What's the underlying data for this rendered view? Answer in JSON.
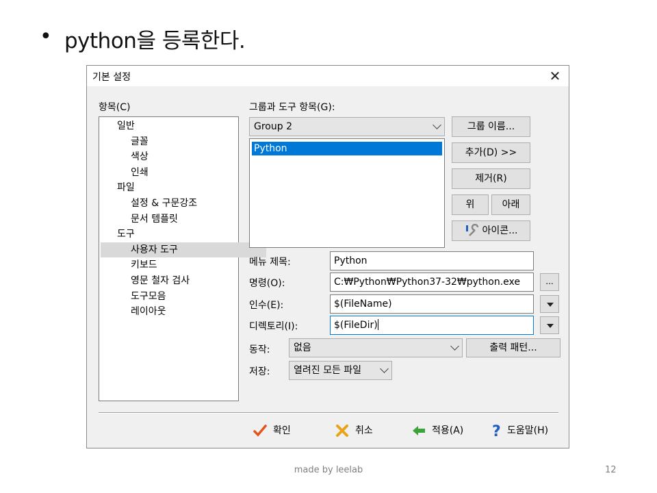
{
  "slide": {
    "bullet": "•",
    "title": "python을 등록한다.",
    "footer": "made by leelab",
    "page_number": "12"
  },
  "dialog": {
    "title": "기본 설정",
    "close": "✕",
    "items_label": "항목(C)",
    "tree": [
      {
        "label": "일반",
        "level": 0
      },
      {
        "label": "글꼴",
        "level": 1
      },
      {
        "label": "색상",
        "level": 1
      },
      {
        "label": "인쇄",
        "level": 1
      },
      {
        "label": "파일",
        "level": 0
      },
      {
        "label": "설정 & 구문강조",
        "level": 1
      },
      {
        "label": "문서 템플릿",
        "level": 1
      },
      {
        "label": "도구",
        "level": 0
      },
      {
        "label": "사용자 도구",
        "level": 1,
        "selected": true
      },
      {
        "label": "키보드",
        "level": 1
      },
      {
        "label": "영문 철자 검사",
        "level": 1
      },
      {
        "label": "도구모음",
        "level": 1
      },
      {
        "label": "레이아웃",
        "level": 1
      }
    ],
    "group_label": "그룹과 도구 항목(G):",
    "group_select": "Group 2",
    "tool_list": [
      "Python"
    ],
    "buttons": {
      "group_name": "그룹 이름...",
      "add": "추가(D) >>",
      "remove": "제거(R)",
      "up": "위",
      "down": "아래",
      "icon": "아이콘..."
    },
    "fields": {
      "menu_title_label": "메뉴 제목:",
      "menu_title_value": "Python",
      "command_label": "명령(O):",
      "command_value": "C:₩Python₩Python37-32₩python.exe",
      "command_browse": "...",
      "args_label": "인수(E):",
      "args_value": "$(FileName)",
      "dir_label": "디렉토리(I):",
      "dir_value": "$(FileDir)"
    },
    "action_label": "동작:",
    "action_value": "없음",
    "output_pattern_button": "출력 패턴...",
    "save_label": "저장:",
    "save_value": "열려진 모든 파일",
    "footer_buttons": {
      "ok": "확인",
      "cancel": "취소",
      "apply": "적용(A)",
      "help": "도움말(H)"
    },
    "colors": {
      "selection": "#0078d7",
      "ok_check": "#e2541c",
      "cancel_x": "#e8a317",
      "apply_arrow": "#3aa33a",
      "help_q": "#1f5fbf"
    }
  }
}
